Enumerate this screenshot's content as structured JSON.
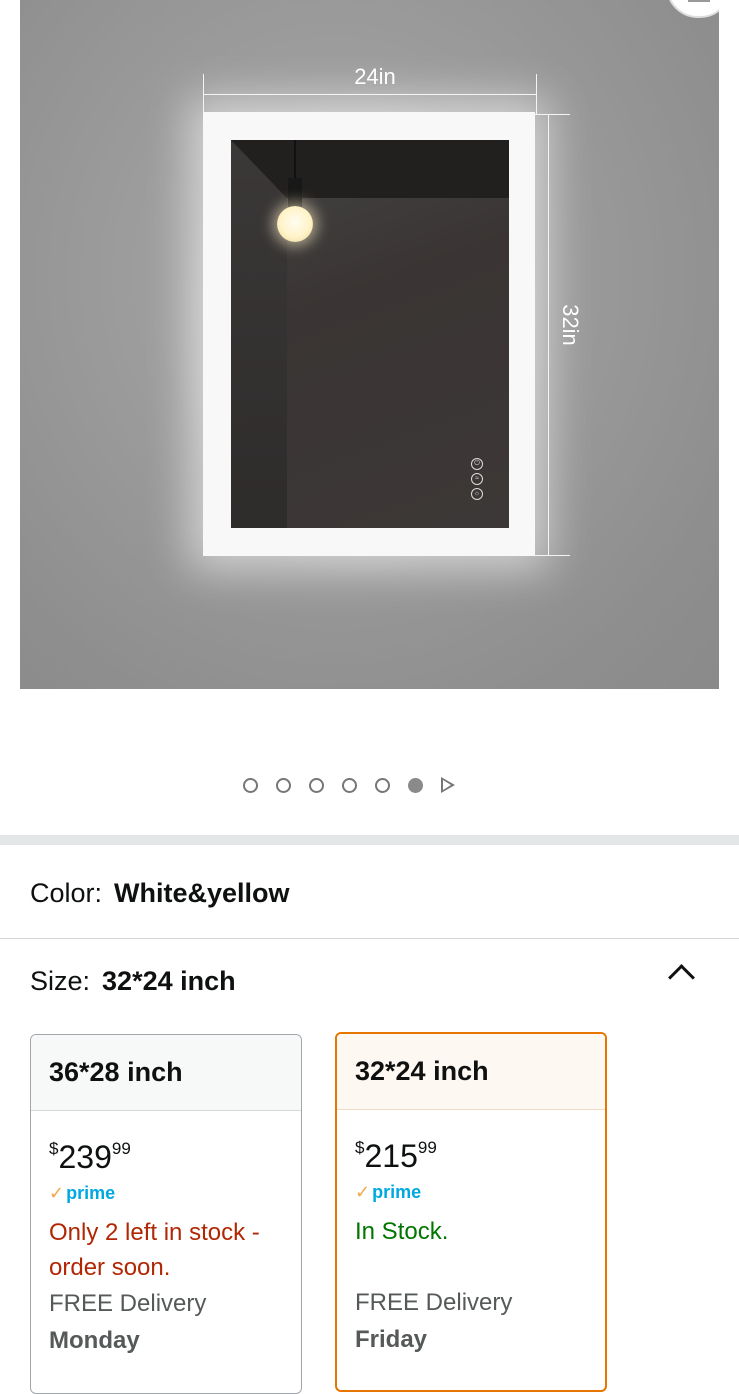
{
  "product_image": {
    "width_label": "24in",
    "height_label": "32in"
  },
  "carousel": {
    "dot_count": 6,
    "active_index": 5
  },
  "color": {
    "label": "Color:",
    "value": "White&yellow"
  },
  "size": {
    "label": "Size:",
    "value": "32*24 inch"
  },
  "size_options": [
    {
      "name": "36*28 inch",
      "currency": "$",
      "price_whole": "239",
      "price_fraction": "99",
      "prime": "prime",
      "stock": "Only 2 left in stock - order soon.",
      "delivery": "FREE Delivery",
      "delivery_day": "Monday",
      "selected": false
    },
    {
      "name": "32*24 inch",
      "currency": "$",
      "price_whole": "215",
      "price_fraction": "99",
      "prime": "prime",
      "stock": "In Stock.",
      "delivery": "FREE Delivery",
      "delivery_day": "Friday",
      "selected": true
    }
  ],
  "colors": {
    "selected_border": "#e77600",
    "in_stock": "#007600",
    "low_stock": "#b12704",
    "prime_blue": "#00a8e1"
  }
}
